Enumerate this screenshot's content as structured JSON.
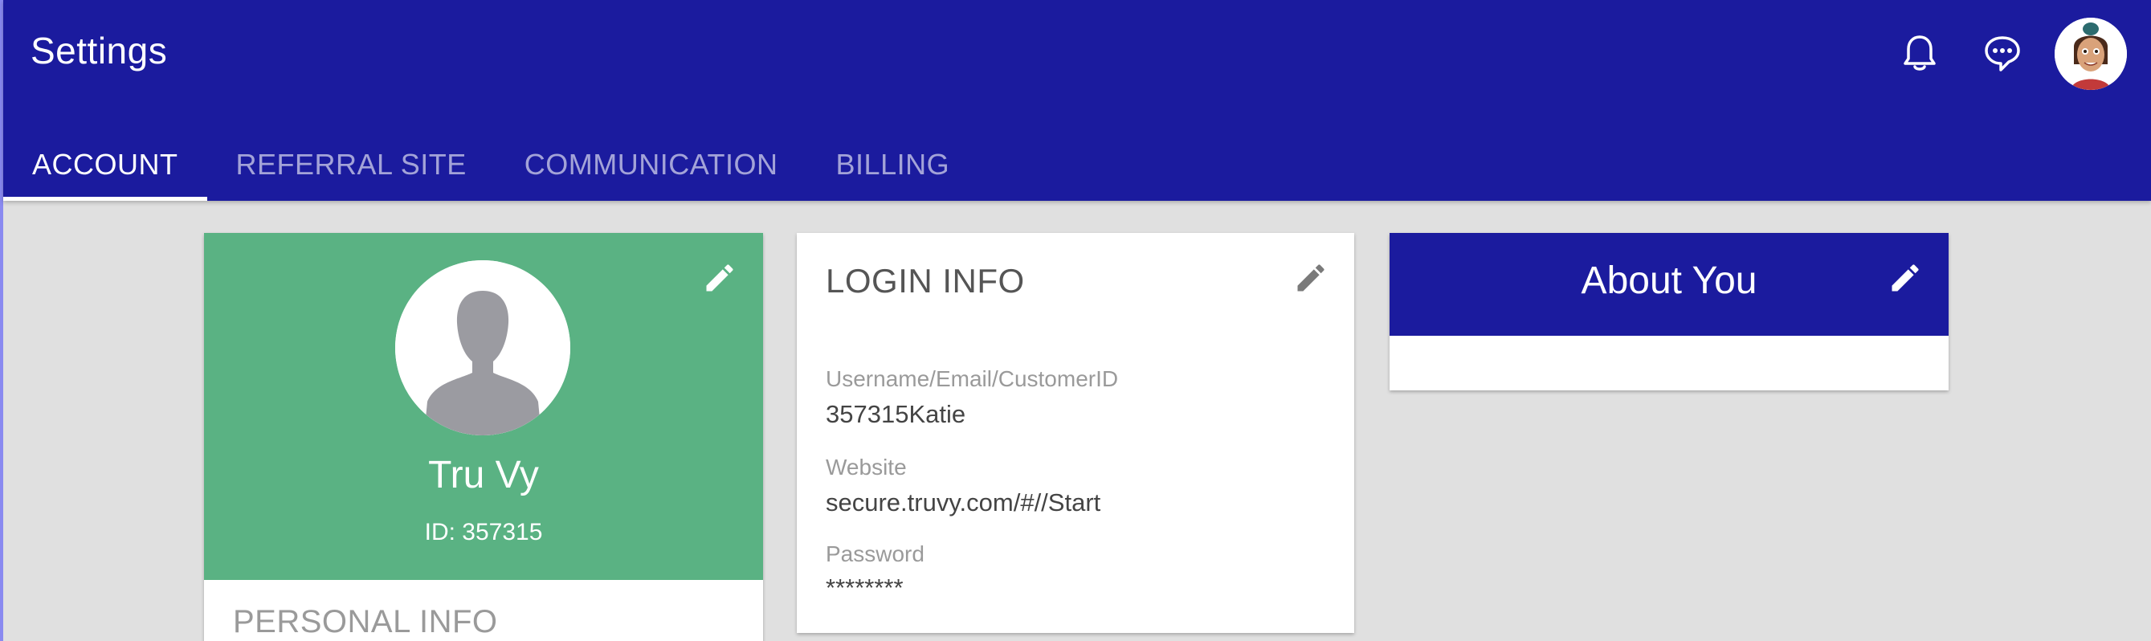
{
  "app": {
    "title": "Settings"
  },
  "header": {
    "icons": [
      "bell-icon",
      "chat-icon"
    ],
    "avatar": "user-avatar"
  },
  "tabs": [
    {
      "label": "ACCOUNT",
      "active": true
    },
    {
      "label": "REFERRAL SITE",
      "active": false
    },
    {
      "label": "COMMUNICATION",
      "active": false
    },
    {
      "label": "BILLING",
      "active": false
    }
  ],
  "profile": {
    "name": "Tru Vy",
    "id_text": "ID: 357315",
    "personal_info_heading": "PERSONAL INFO"
  },
  "login_info": {
    "heading": "LOGIN INFO",
    "fields": [
      {
        "label": "Username/Email/CustomerID",
        "value": "357315Katie"
      },
      {
        "label": "Website",
        "value": "secure.truvy.com/#//Start"
      },
      {
        "label": "Password",
        "value": "********"
      }
    ]
  },
  "about": {
    "title": "About You"
  },
  "colors": {
    "primary": "#1b1b9e",
    "profile_green": "#5ab283",
    "background": "#e0e0e0"
  }
}
